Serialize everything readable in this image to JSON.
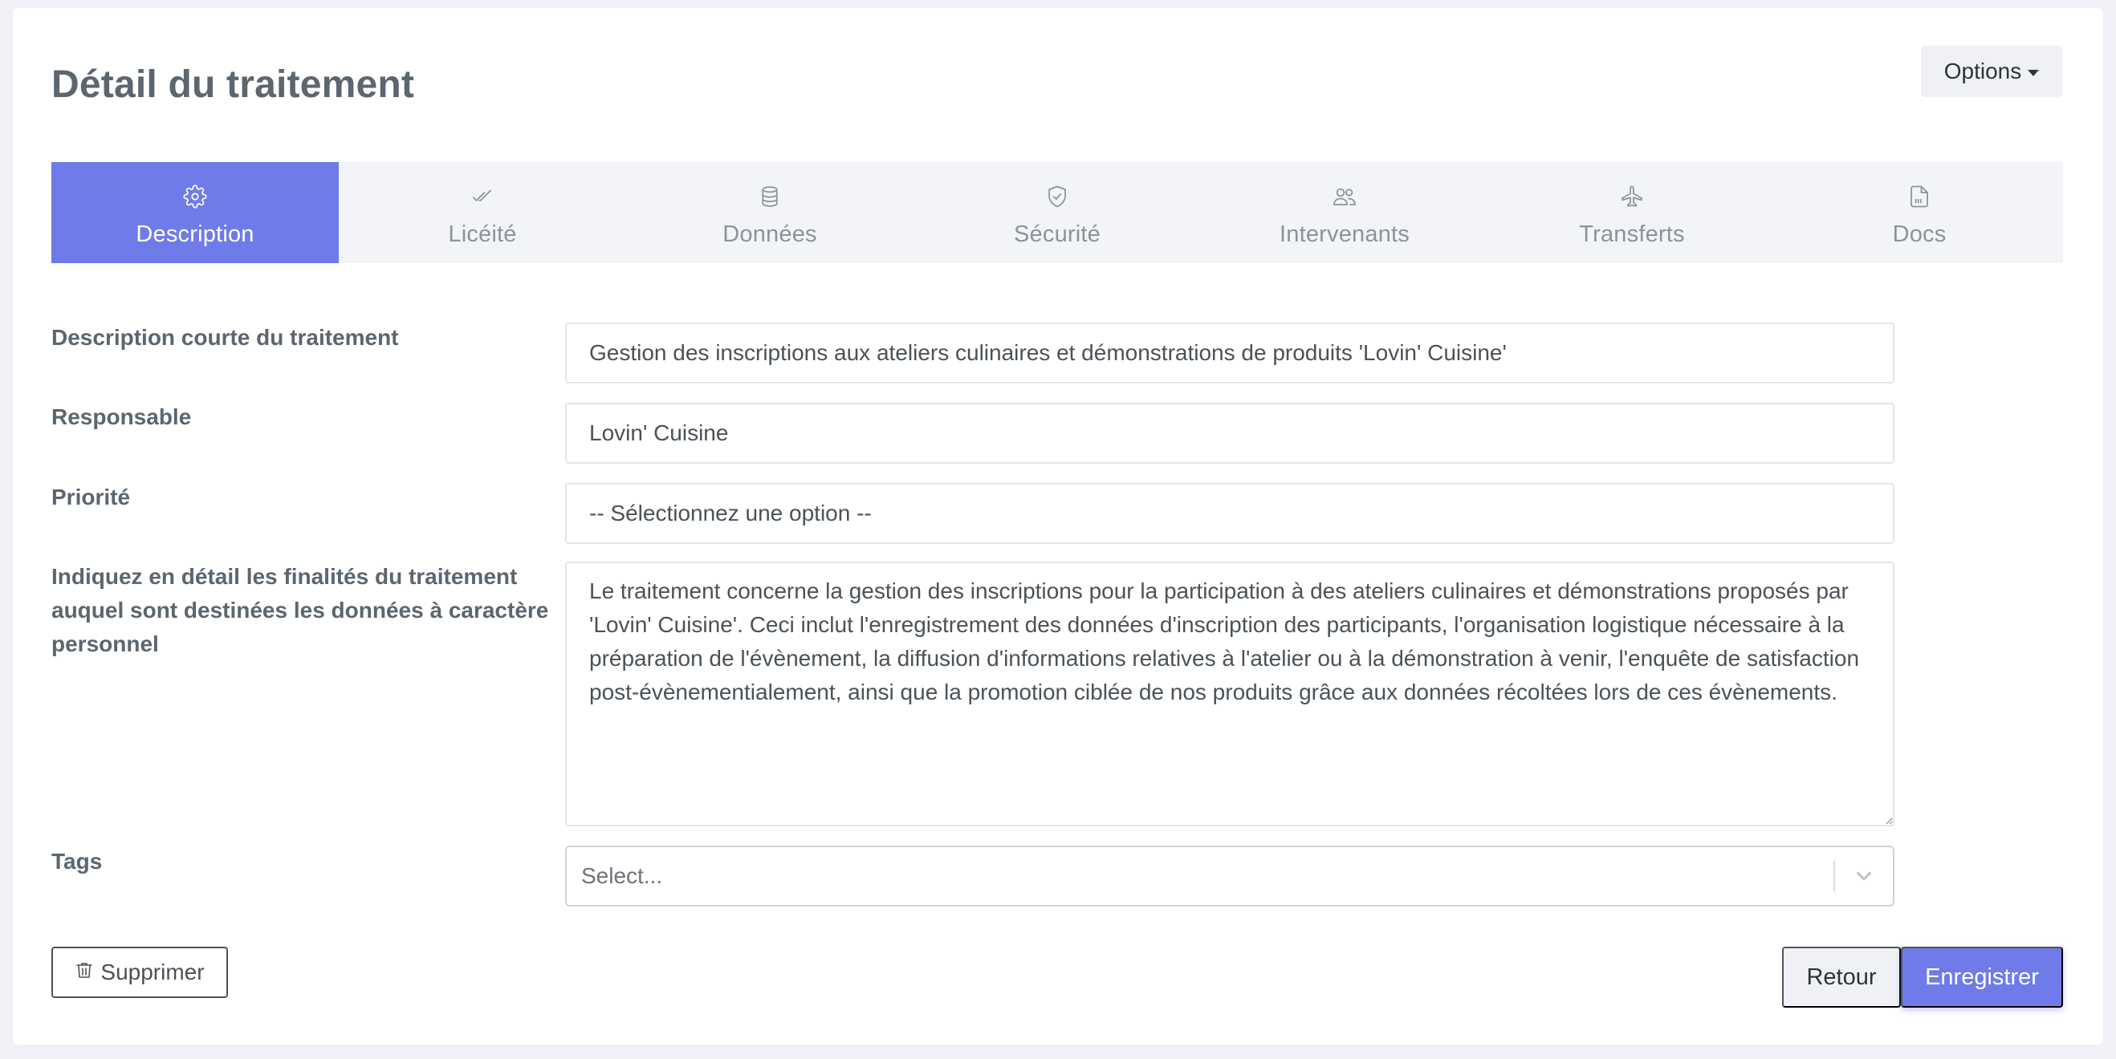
{
  "header": {
    "title": "Détail du traitement",
    "options_label": "Options"
  },
  "tabs": [
    {
      "label": "Description",
      "icon": "gear-icon",
      "active": true
    },
    {
      "label": "Licéité",
      "icon": "double-check-icon",
      "active": false
    },
    {
      "label": "Données",
      "icon": "database-icon",
      "active": false
    },
    {
      "label": "Sécurité",
      "icon": "shield-check-icon",
      "active": false
    },
    {
      "label": "Intervenants",
      "icon": "users-icon",
      "active": false
    },
    {
      "label": "Transferts",
      "icon": "airplane-icon",
      "active": false
    },
    {
      "label": "Docs",
      "icon": "document-icon",
      "active": false
    }
  ],
  "form": {
    "short_description": {
      "label": "Description courte du traitement",
      "value": "Gestion des inscriptions aux ateliers culinaires et démonstrations de produits 'Lovin' Cuisine'"
    },
    "responsible": {
      "label": "Responsable",
      "value": "Lovin' Cuisine"
    },
    "priority": {
      "label": "Priorité",
      "value": "-- Sélectionnez une option --"
    },
    "purposes": {
      "label": "Indiquez en détail les finalités du traitement auquel sont destinées les données à caractère personnel",
      "value": "Le traitement concerne la gestion des inscriptions pour la participation à des ateliers culinaires et démonstrations proposés par 'Lovin' Cuisine'. Ceci inclut l'enregistrement des données d'inscription des participants, l'organisation logistique nécessaire à la préparation de l'évènement, la diffusion d'informations relatives à l'atelier ou à la démonstration à venir, l'enquête de satisfaction post-évènementialement, ainsi que la promotion ciblée de nos produits grâce aux données récoltées lors de ces évènements."
    },
    "tags": {
      "label": "Tags",
      "placeholder": "Select..."
    }
  },
  "actions": {
    "delete_label": "Supprimer",
    "back_label": "Retour",
    "save_label": "Enregistrer"
  },
  "colors": {
    "accent": "#6f7be8",
    "tab_bar": "#f3f4f8",
    "text_muted": "#5c6670"
  }
}
